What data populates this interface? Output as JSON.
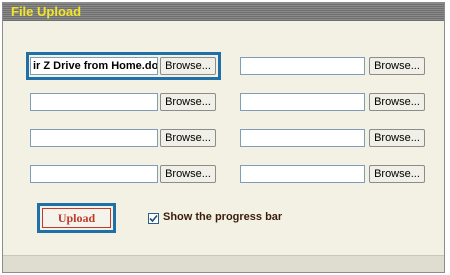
{
  "panel": {
    "title": "File Upload"
  },
  "files": {
    "rows": [
      {
        "left_value": "ir Z Drive from Home.doc",
        "left_browse": "Browse...",
        "right_value": "",
        "right_browse": "Browse..."
      },
      {
        "left_value": "",
        "left_browse": "Browse...",
        "right_value": "",
        "right_browse": "Browse..."
      },
      {
        "left_value": "",
        "left_browse": "Browse...",
        "right_value": "",
        "right_browse": "Browse..."
      },
      {
        "left_value": "",
        "left_browse": "Browse...",
        "right_value": "",
        "right_browse": "Browse..."
      }
    ]
  },
  "actions": {
    "upload_label": "Upload",
    "progress_checkbox_label": "Show the progress bar",
    "progress_checked": true
  },
  "colors": {
    "title_text": "#f2e62b",
    "highlight": "#1f6fa8",
    "upload_text": "#c0392b",
    "panel_bg": "#f3f1e4"
  }
}
